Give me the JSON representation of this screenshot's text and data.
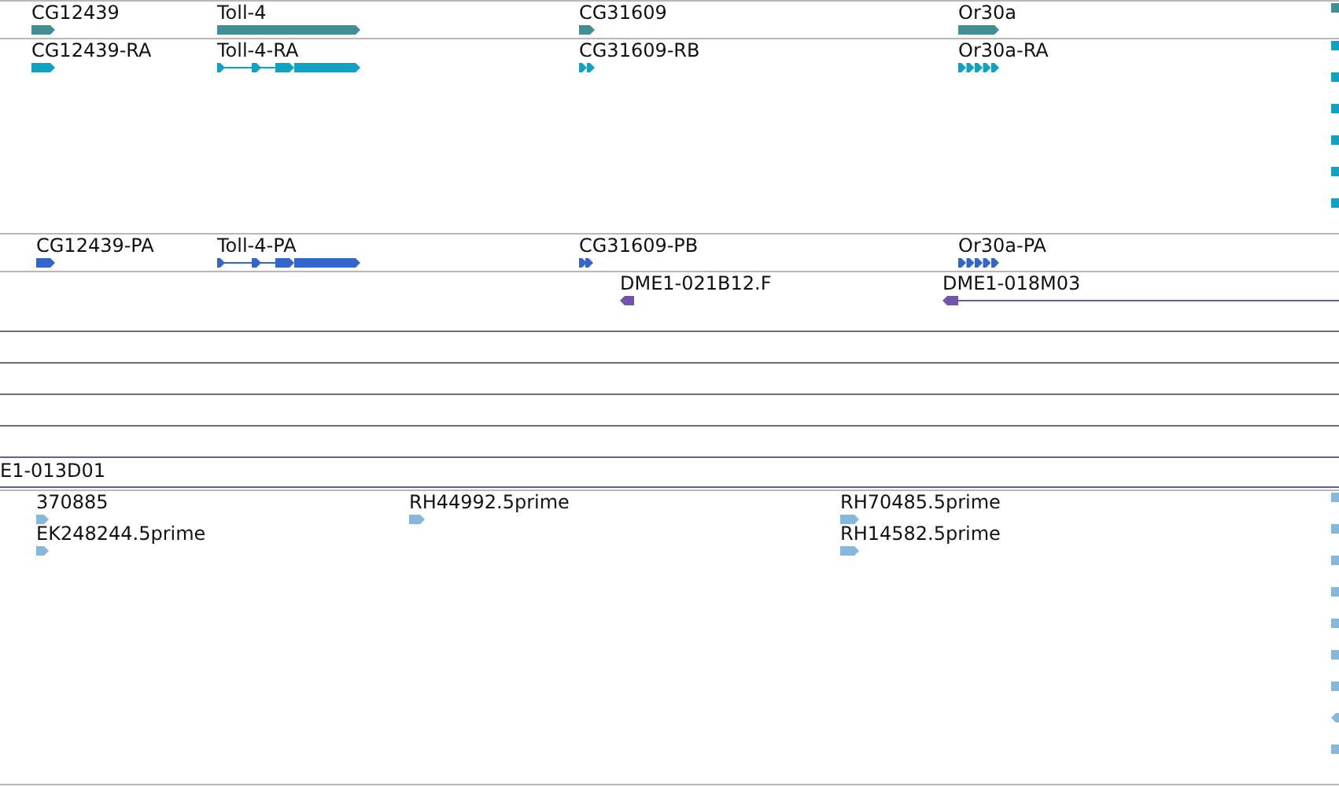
{
  "tracks": [
    {
      "kind": "gene",
      "features": [
        {
          "label": "CG12439",
          "reverse": false,
          "kind": "block"
        },
        {
          "label": "Toll-4",
          "reverse": false,
          "kind": "block"
        },
        {
          "label": "CG31609",
          "reverse": false,
          "kind": "block"
        },
        {
          "label": "Or30a",
          "reverse": false,
          "kind": "block"
        },
        {
          "reverse": false,
          "kind": "block"
        }
      ]
    },
    {
      "kind": "transcript",
      "features": [
        {
          "label": "CG12439-RA",
          "reverse": false,
          "kind": "block"
        },
        {
          "label": "Toll-4-RA",
          "reverse": false,
          "kind": "spliced"
        },
        {
          "label": "CG31609-RB",
          "reverse": false,
          "kind": "chevrons"
        },
        {
          "label": "Or30a-RA",
          "reverse": false,
          "kind": "chevrons"
        },
        {
          "reverse": false,
          "kind": "block"
        },
        {
          "reverse": false,
          "kind": "block"
        },
        {
          "reverse": false,
          "kind": "block"
        },
        {
          "reverse": false,
          "kind": "block"
        },
        {
          "reverse": false,
          "kind": "block"
        },
        {
          "reverse": false,
          "kind": "block"
        }
      ]
    },
    {
      "kind": "protein",
      "features": [
        {
          "label": "CG12439-PA",
          "reverse": false,
          "kind": "block"
        },
        {
          "label": "Toll-4-PA",
          "reverse": false,
          "kind": "spliced"
        },
        {
          "label": "CG31609-PB",
          "reverse": false,
          "kind": "chevrons"
        },
        {
          "label": "Or30a-PA",
          "reverse": false,
          "kind": "chevrons"
        }
      ]
    },
    {
      "kind": "clone",
      "features": [
        {
          "label": "DME1-021B12.F",
          "reverse": true,
          "kind": "block"
        },
        {
          "label": "DME1-018M03",
          "reverse": true,
          "kind": "extended"
        }
      ]
    },
    {
      "kind": "empty"
    },
    {
      "kind": "empty"
    },
    {
      "kind": "empty"
    },
    {
      "kind": "empty"
    },
    {
      "kind": "clone_edge",
      "features": [
        {
          "label": "E1-013D01",
          "kind": "label"
        }
      ]
    },
    {
      "kind": "est",
      "features": [
        {
          "label": "370885",
          "reverse": false,
          "kind": "block"
        },
        {
          "label": "EK248244.5prime",
          "reverse": false,
          "kind": "block"
        },
        {
          "label": "RH44992.5prime",
          "reverse": false,
          "kind": "block"
        },
        {
          "label": "RH70485.5prime",
          "reverse": false,
          "kind": "block"
        },
        {
          "label": "RH14582.5prime",
          "reverse": false,
          "kind": "block"
        },
        {
          "reverse": false,
          "kind": "block"
        },
        {
          "reverse": false,
          "kind": "block"
        },
        {
          "reverse": false,
          "kind": "block"
        },
        {
          "reverse": false,
          "kind": "block"
        },
        {
          "reverse": false,
          "kind": "block"
        },
        {
          "reverse": false,
          "kind": "block"
        },
        {
          "reverse": false,
          "kind": "block"
        },
        {
          "reverse": true,
          "kind": "block"
        },
        {
          "reverse": false,
          "kind": "block"
        }
      ]
    }
  ]
}
